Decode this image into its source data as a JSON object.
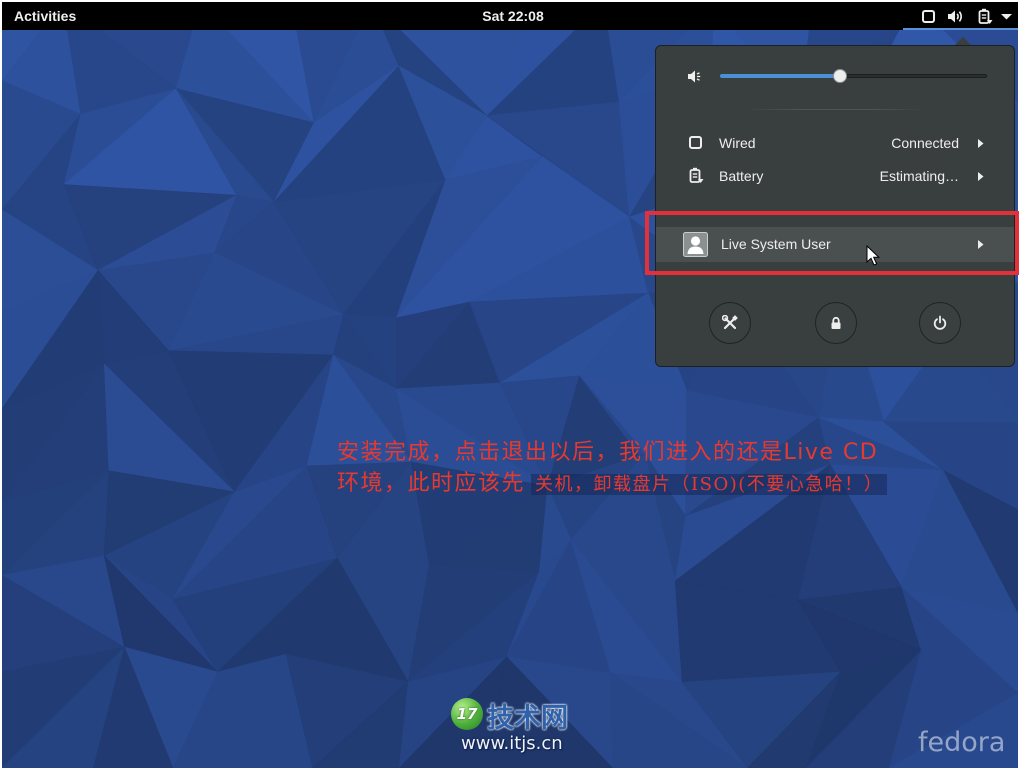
{
  "top_bar": {
    "activities_label": "Activities",
    "clock": "Sat 22:08",
    "status_icons": [
      "network-wired-icon",
      "volume-icon",
      "battery-icon",
      "dropdown-arrow-icon"
    ]
  },
  "system_menu": {
    "volume": {
      "icon": "volume-low-icon",
      "level": 0.45
    },
    "rows": [
      {
        "icon": "network-wired-icon",
        "label": "Wired",
        "value": "Connected"
      },
      {
        "icon": "battery-icon",
        "label": "Battery",
        "value": "Estimating…"
      }
    ],
    "user": {
      "icon": "avatar-icon",
      "label": "Live System User",
      "highlighted": true
    },
    "actions": [
      {
        "icon": "settings-icon"
      },
      {
        "icon": "lock-icon"
      },
      {
        "icon": "power-icon"
      }
    ]
  },
  "annotation": {
    "line1": "安装完成，点击退出以后，我们进入的还是Live CD",
    "line2_start": "环境，此时应该先",
    "line2_end": "关机，卸载盘片（ISO)(不要心急哈！）",
    "text_color": "#e8392f",
    "box_color": "#e5303a"
  },
  "watermark": {
    "logo_number": "17",
    "brand": "技术网",
    "url": "www.itjs.cn"
  },
  "branding": {
    "fedora_logo": "fedora"
  },
  "colors": {
    "top_bar": "#000000",
    "menu_bg": "#393f3f",
    "menu_row_highlight": "#4a5050",
    "slider_fill": "#4a90d9",
    "wallpaper_base": "#2b4b90"
  }
}
